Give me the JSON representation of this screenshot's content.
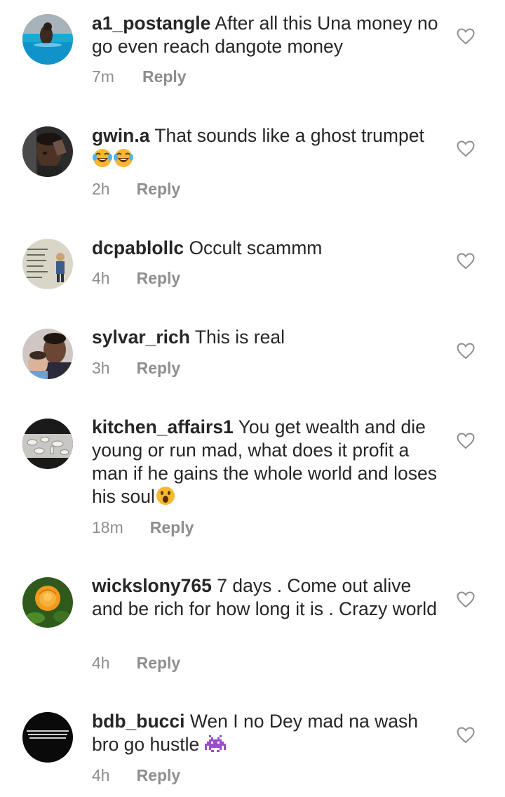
{
  "comments": [
    {
      "username": "a1_postangle",
      "text": "After all this Una money no go even reach dangote money",
      "time": "7m",
      "reply_label": "Reply",
      "avatar": "person-in-pool-avatar",
      "emoji": []
    },
    {
      "username": "gwin.a",
      "text": "That sounds like a ghost trumpet",
      "time": "2h",
      "reply_label": "Reply",
      "avatar": "man-portrait-avatar",
      "emoji": [
        "face-with-tears-of-joy-emoji",
        "face-with-tears-of-joy-emoji"
      ]
    },
    {
      "username": "dcpablollc",
      "text": "Occult scammm",
      "time": "4h",
      "reply_label": "Reply",
      "avatar": "meme-text-avatar",
      "emoji": []
    },
    {
      "username": "sylvar_rich",
      "text": "This is real",
      "time": "3h",
      "reply_label": "Reply",
      "avatar": "man-with-baby-avatar",
      "emoji": []
    },
    {
      "username": "kitchen_affairs1",
      "text": "You get wealth and die young or run mad, what does it profit a man if he gains the whole world and loses his soul",
      "time": "18m",
      "reply_label": "Reply",
      "avatar": "dishes-avatar",
      "emoji": [
        "face-with-open-mouth-emoji"
      ]
    },
    {
      "username": "wickslony765",
      "text": "7 days . Come out alive and be rich for how long it is . Crazy world",
      "time": "4h",
      "reply_label": "Reply",
      "avatar": "orange-rose-avatar",
      "emoji": []
    },
    {
      "username": "bdb_bucci",
      "text": "Wen I no Dey mad na wash bro go hustle",
      "time": "4h",
      "reply_label": "Reply",
      "avatar": "black-text-avatar",
      "emoji": [
        "alien-monster-emoji"
      ]
    }
  ],
  "colors": {
    "text": "#262626",
    "secondary": "#8e8e8e",
    "emoji_yellow": "#f7b731",
    "emoji_purple": "#9b4dca"
  }
}
